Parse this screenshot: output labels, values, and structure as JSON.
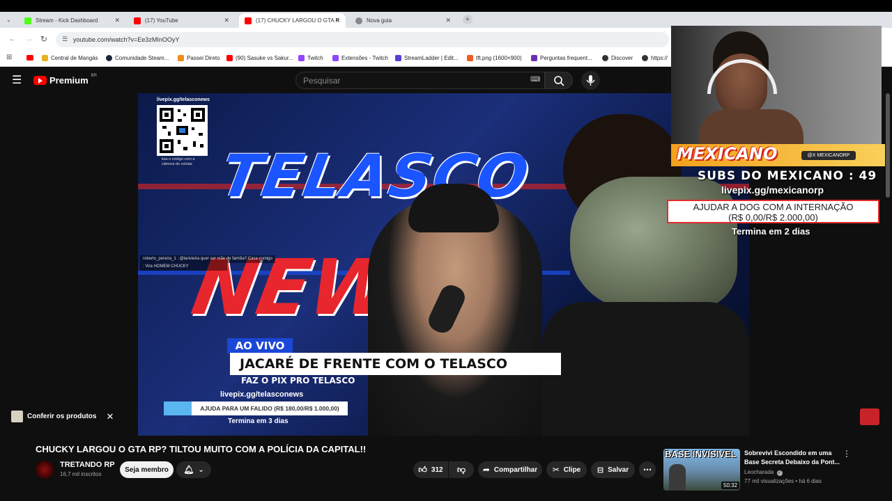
{
  "browser": {
    "tabs": [
      {
        "label": "Stream - Kick Dashboard",
        "color": "#53fc18"
      },
      {
        "label": "(17) YouTube",
        "color": "#ff0000"
      },
      {
        "label": "(17) CHUCKY LARGOU O GTA R",
        "color": "#ff0000"
      },
      {
        "label": "Nova guia",
        "color": "#888888"
      }
    ],
    "url": "youtube.com/watch?v=Ee3zMInOOyY",
    "bookmarks": [
      {
        "label": "Central de Mangás",
        "color": "#e7b020"
      },
      {
        "label": "Comunidade Steam...",
        "color": "#1b2838"
      },
      {
        "label": "Passei Direto",
        "color": "#f08c1a"
      },
      {
        "label": "(90) Sasuke vs Sakur...",
        "color": "#ff0000"
      },
      {
        "label": "Twitch",
        "color": "#9146ff"
      },
      {
        "label": "Extensões - Twitch",
        "color": "#9146ff"
      },
      {
        "label": "StreamLadder | Edit...",
        "color": "#5a3fd0"
      },
      {
        "label": "tft.png (1600×900)",
        "color": "#f05a24"
      },
      {
        "label": "Perguntas frequent...",
        "color": "#6a2fb0"
      },
      {
        "label": "Discover",
        "color": "#333333"
      },
      {
        "label": "https://",
        "color": "#333333"
      }
    ]
  },
  "youtube": {
    "logo_text": "Premium",
    "region": "BR",
    "search_placeholder": "Pesquisar"
  },
  "video": {
    "qr_url": "livepix.gg/telasconews",
    "qr_caption": "leia o código com a câmera do celular.",
    "headline_telasco": "TELASCO",
    "headline_news": "NEWS",
    "ao_vivo": "AO VIVO",
    "lower_third": "JACARÉ DE FRENTE COM O TELASCO",
    "pix_line": "FAZ O PIX PRO TELASCO",
    "livepix": "livepix.gg/telasconews",
    "goal": "AJUDA PARA UM FALIDO (R$ 180,00/R$ 1.000,00)",
    "goal_fraction": 0.18,
    "termina": "Termina em 3 dias",
    "chat": [
      "roberto_pereira_1 : @larivieira quer ser mãe de família? Casa comigo",
      ": Vira HOMEM CHUCKY"
    ]
  },
  "overlay": {
    "logo": "MEXICANO",
    "handle": "@X MEXICANORP",
    "subs": "SUBS DO MEXICANO : 49",
    "livepix": "livepix.gg/mexicanorp",
    "goal_line1": "AJUDAR A DOG COM A INTERNAÇÃO",
    "goal_line2": "(R$ 0,00/R$ 2.000,00)",
    "termina": "Termina em 2 dias"
  },
  "below": {
    "conferir": "Conferir os produtos",
    "title": "CHUCKY LARGOU O GTA RP? TILTOU MUITO COM A POLÍCIA DA CAPITAL!!",
    "channel": "TRETANDO RP",
    "subscribers": "16,7 mil inscritos",
    "join": "Seja membro",
    "likes": "312",
    "share": "Compartilhar",
    "clip": "Clipe",
    "save": "Salvar"
  },
  "suggestion": {
    "thumb_text": "BASE INVISIVEL",
    "duration": "50:32",
    "title": "Sobrevivi Escondido em uma Base Secreta Debaixo da Pont...",
    "channel": "Leocharada",
    "meta": "77 mil visualizações • há 6 dias"
  }
}
